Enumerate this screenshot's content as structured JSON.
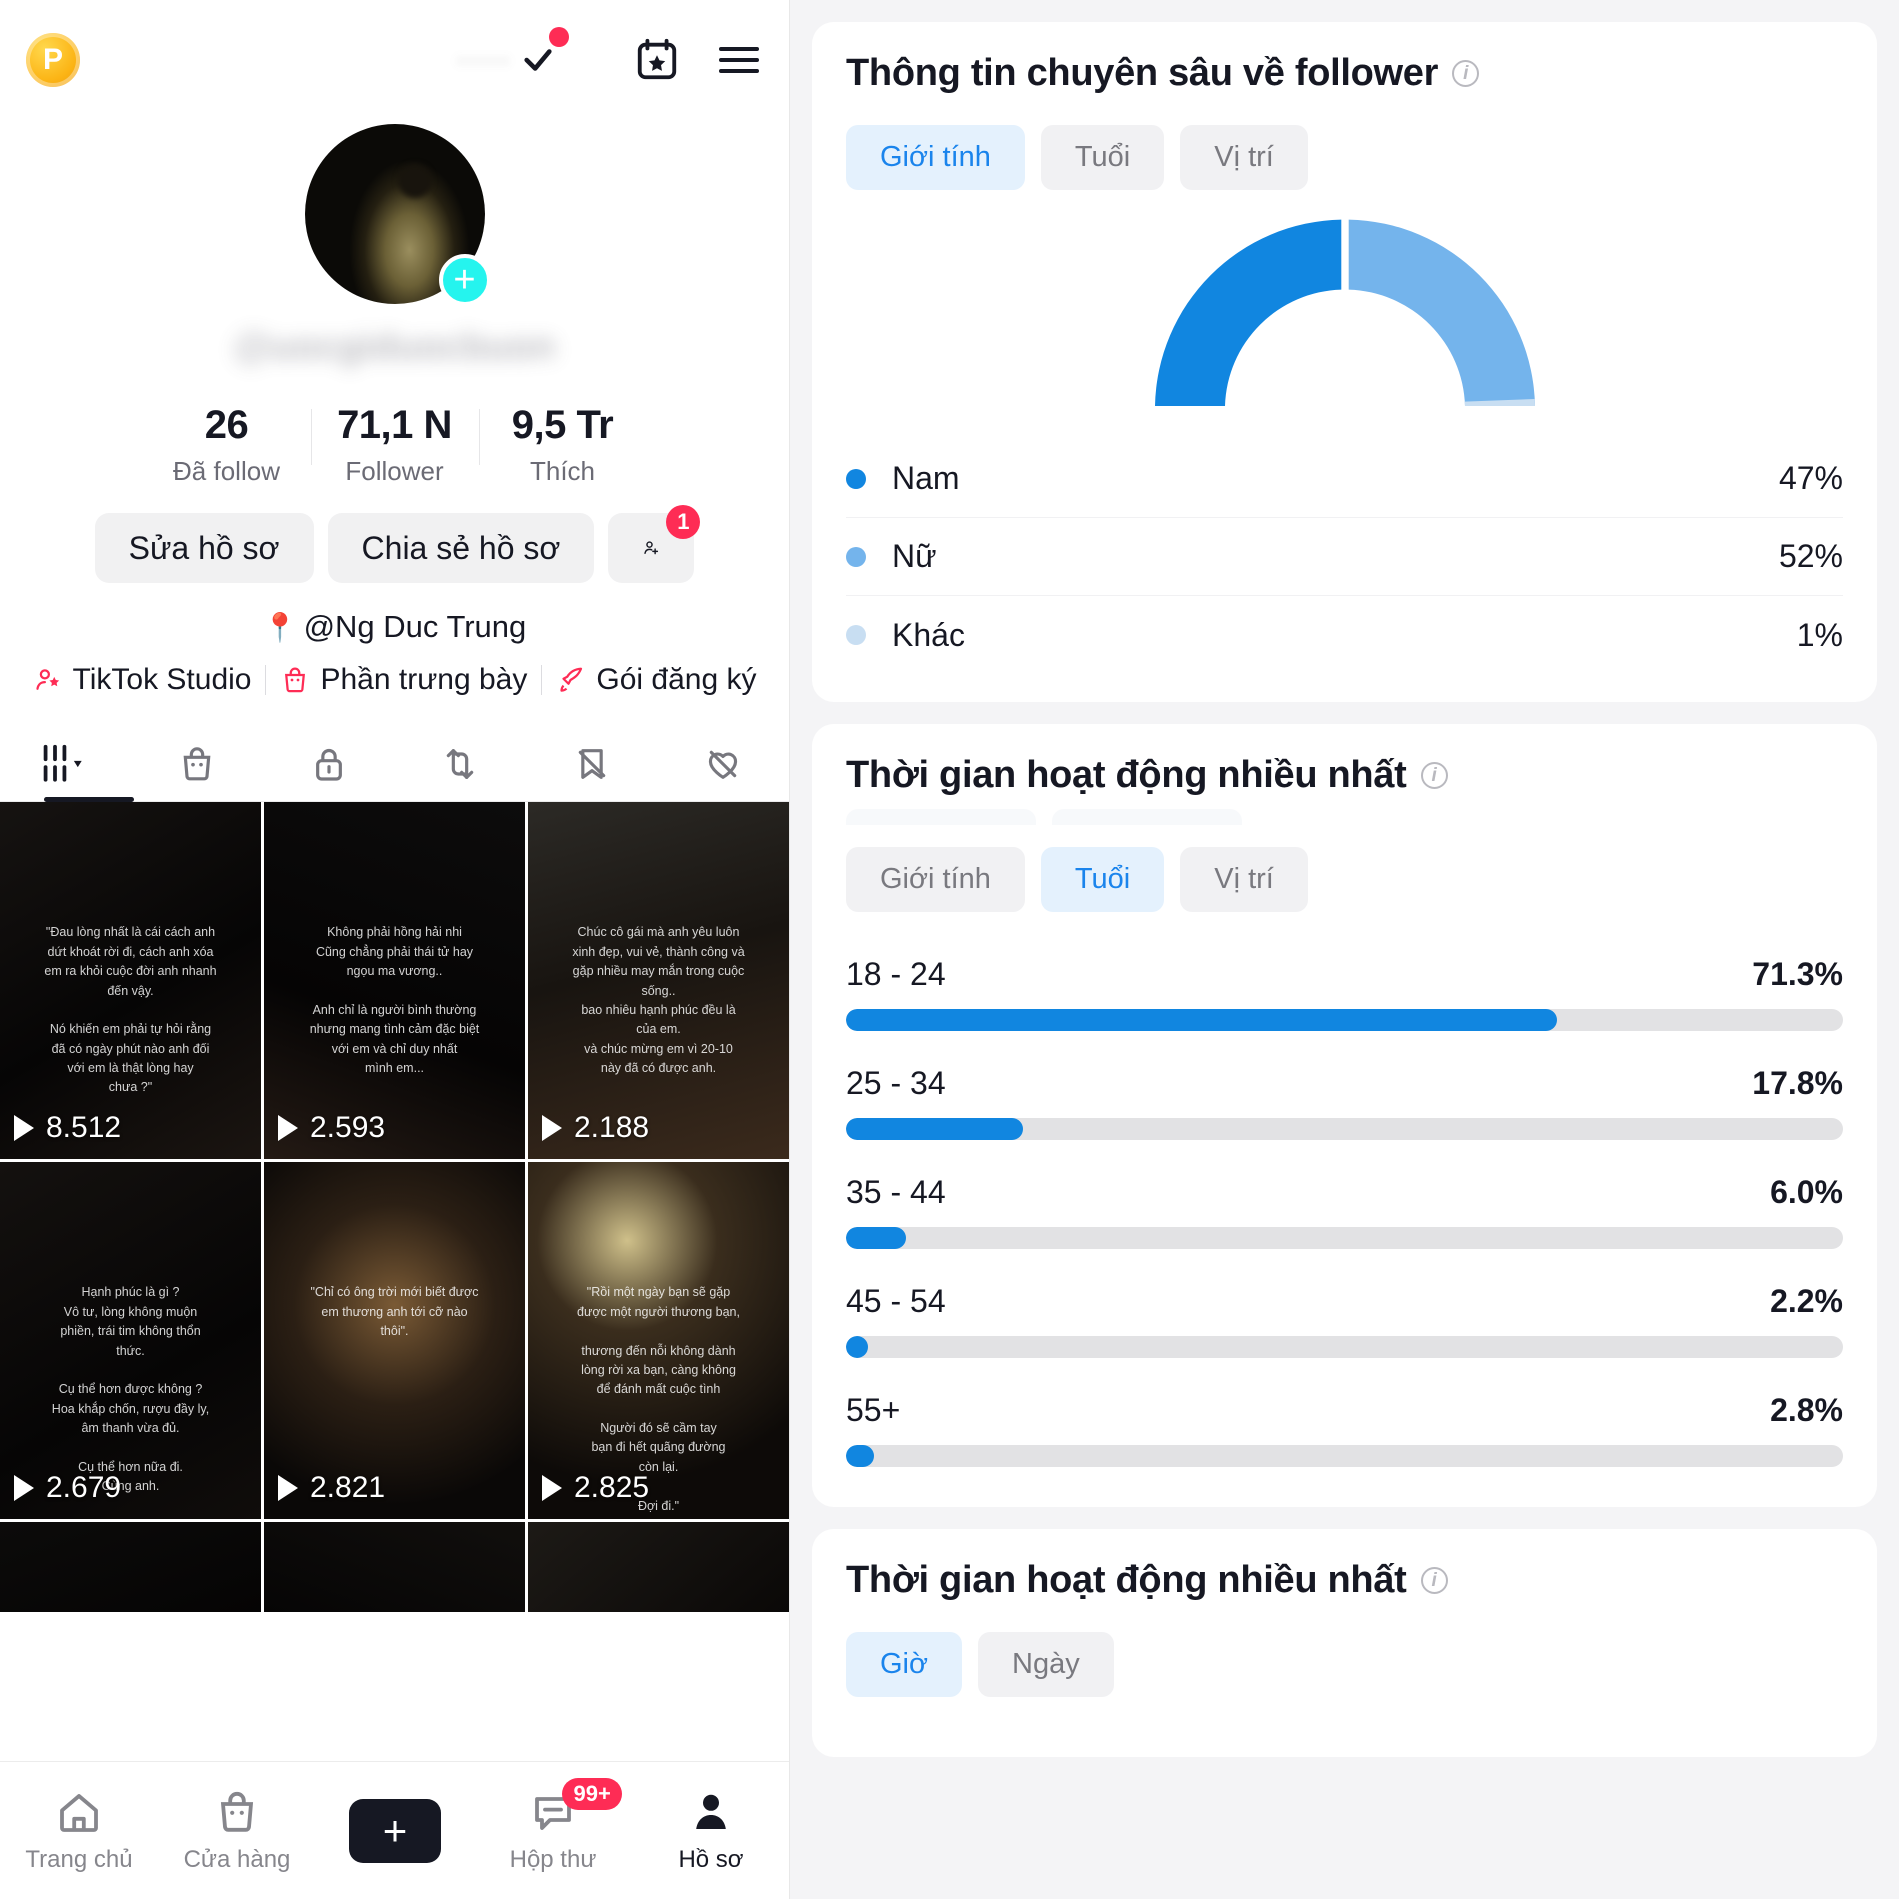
{
  "profile": {
    "topbar": {
      "coin_label": "P",
      "handle_obscured": "·····",
      "verified_icon": "check-icon",
      "notification_dot": true,
      "live_icon": "live-event-icon",
      "menu_icon": "hamburger-icon"
    },
    "avatar_add_label": "+",
    "username_obscured": "@uocgiduocbuon",
    "stats": [
      {
        "value": "26",
        "label": "Đã follow"
      },
      {
        "value": "71,1 N",
        "label": "Follower"
      },
      {
        "value": "9,5 Tr",
        "label": "Thích"
      }
    ],
    "actions": {
      "edit_label": "Sửa hồ sơ",
      "share_label": "Chia sẻ hồ sơ",
      "add_friend_badge": "1"
    },
    "bio": {
      "pin": "📍",
      "text": "@Ng Duc Trung"
    },
    "links": [
      {
        "label": "TikTok Studio",
        "icon": "studio-person-star-icon"
      },
      {
        "label": "Phần trưng bày",
        "icon": "shop-bag-icon"
      },
      {
        "label": "Gói đăng ký",
        "icon": "subscription-rocket-icon"
      }
    ],
    "tabs": [
      {
        "name": "posts-tab",
        "icon": "grid-bars-icon",
        "active": true
      },
      {
        "name": "shop-tab",
        "icon": "bag-icon",
        "active": false
      },
      {
        "name": "private-tab",
        "icon": "lock-icon",
        "active": false
      },
      {
        "name": "reposts-tab",
        "icon": "repost-icon",
        "active": false
      },
      {
        "name": "hidden-tab",
        "icon": "bookmark-off-icon",
        "active": false
      },
      {
        "name": "liked-tab",
        "icon": "heart-off-icon",
        "active": false
      }
    ],
    "videos": [
      {
        "plays": "8.512",
        "caption": "\"Đau lòng nhất là cái cách anh\ndứt khoát rời đi, cách anh xóa\nem ra khỏi cuộc đời anh nhanh\nđến vậy.\n\nNó khiến em phải tự hỏi rằng\nđã có ngày phút nào anh đối\nvới em là thật lòng hay\nchưa ?\""
      },
      {
        "plays": "2.593",
        "caption": "Không phải hồng hải nhi\nCũng chẳng phải thái tử hay\nngọu ma vương..\n\nAnh chỉ là người bình thường\nnhưng mang tình cảm đặc biệt\nvới em và chỉ duy nhất\nmình em..."
      },
      {
        "plays": "2.188",
        "caption": "Chúc cô gái mà anh yêu luôn\nxinh đẹp, vui vẻ, thành công và\ngặp nhiều may mắn trong cuộc\nsống..\nbao nhiêu hạnh phúc đều là\ncủa em.\nvà chúc mừng em vì 20-10\nnày đã có được anh."
      },
      {
        "plays": "2.679",
        "caption": "Hạnh phúc là gì ?\nVô tư, lòng không muộn\nphiền, trái tim không thổn\nthức.\n\nCụ thể hơn được không ?\nHoa khắp chốn, rượu đầy ly,\nâm thanh vừa đủ.\n\nCụ thể hơn nữa đi.\nCùng anh."
      },
      {
        "plays": "2.821",
        "caption": "\"Chỉ có ông trời mới biết được\nem thương anh tới cỡ nào\nthôi\"."
      },
      {
        "plays": "2.825",
        "caption": "\"Rồi một ngày bạn sẽ gặp\nđược một người thương bạn,\n\nthương đến nỗi không dành\nlòng rời xa bạn, càng không\nđể đánh mất cuộc tình\n\nNgười đó sẽ cầm tay\nbạn đi hết quãng đường\ncòn lại.\n\nĐợi đi.\""
      }
    ],
    "bottom_nav": [
      {
        "label": "Trang chủ",
        "icon": "home-icon",
        "active": false
      },
      {
        "label": "Cửa hàng",
        "icon": "shop-bag-icon",
        "active": false
      },
      {
        "label": "",
        "icon": "create-plus-icon",
        "active": false
      },
      {
        "label": "Hộp thư",
        "icon": "inbox-message-icon",
        "badge": "99+",
        "active": false
      },
      {
        "label": "Hồ sơ",
        "icon": "profile-person-icon",
        "active": true
      }
    ]
  },
  "analytics": {
    "follower_insights": {
      "title": "Thông tin chuyên sâu về follower",
      "info_icon": "info-icon",
      "tabs": [
        {
          "label": "Giới tính",
          "active": true
        },
        {
          "label": "Tuổi",
          "active": false
        },
        {
          "label": "Vị trí",
          "active": false
        }
      ]
    },
    "activity_age": {
      "title": "Thời gian hoạt động nhiều nhất",
      "info_icon": "info-icon",
      "tabs": [
        {
          "label": "Giới tính",
          "active": false
        },
        {
          "label": "Tuổi",
          "active": true
        },
        {
          "label": "Vị trí",
          "active": false
        }
      ]
    },
    "activity_time": {
      "title": "Thời gian hoạt động nhiều nhất",
      "info_icon": "info-icon",
      "tabs": [
        {
          "label": "Giờ",
          "active": true
        },
        {
          "label": "Ngày",
          "active": false
        }
      ]
    }
  },
  "colors": {
    "accent_blue": "#1186e0",
    "accent_blue_light": "#74b4ec",
    "accent_blue_lighter": "#c8def2",
    "tab_active_bg": "#e4f1fd",
    "tab_active_text": "#1a84ec",
    "tiktok_red": "#fe2c55",
    "tiktok_cyan": "#25f4ee",
    "track_grey": "#e2e2e4"
  },
  "chart_data": [
    {
      "type": "pie",
      "title": "Thông tin chuyên sâu về follower",
      "subtitle": "Giới tính",
      "legend_position": "bottom",
      "labels": [
        "Nam",
        "Nữ",
        "Khác"
      ],
      "values": [
        47,
        52,
        1
      ],
      "display_values": [
        "47%",
        "52%",
        "1%"
      ],
      "colors": [
        "#1186e0",
        "#74b4ec",
        "#c8def2"
      ],
      "shape": "semicircle-donut"
    },
    {
      "type": "bar",
      "orientation": "horizontal",
      "title": "Thời gian hoạt động nhiều nhất",
      "subtitle": "Tuổi",
      "categories": [
        "18 - 24",
        "25 - 34",
        "35 - 44",
        "45 - 54",
        "55+"
      ],
      "values": [
        71.3,
        17.8,
        6.0,
        2.2,
        2.8
      ],
      "display_values": [
        "71.3%",
        "17.8%",
        "6.0%",
        "2.2%",
        "2.8%"
      ],
      "xlabel": "",
      "ylabel": "",
      "xlim": [
        0,
        100
      ],
      "grid": false,
      "bar_color": "#1186e0",
      "track_color": "#e2e2e4"
    }
  ]
}
